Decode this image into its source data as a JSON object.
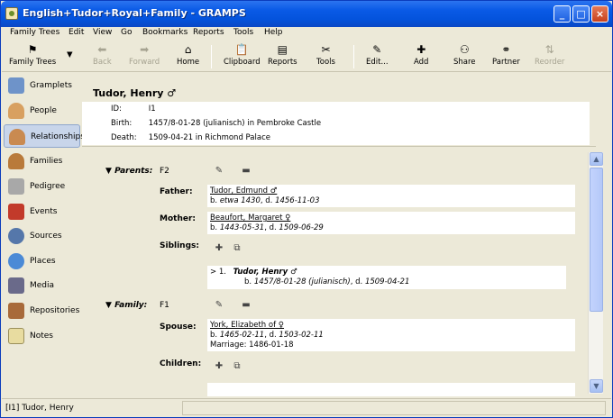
{
  "window": {
    "title": "English+Tudor+Royal+Family - GRAMPS",
    "controls": [
      "_",
      "□",
      "×"
    ]
  },
  "menu": [
    "Family Trees",
    "Edit",
    "View",
    "Go",
    "Bookmarks",
    "Reports",
    "Tools",
    "Help"
  ],
  "toolbar": {
    "family_trees": "Family Trees",
    "back": "Back",
    "forward": "Forward",
    "home": "Home",
    "clipboard": "Clipboard",
    "reports": "Reports",
    "tools": "Tools",
    "edit": "Edit...",
    "add": "Add",
    "share": "Share",
    "partner": "Partner",
    "reorder": "Reorder"
  },
  "sidebar": {
    "items": [
      {
        "label": "Gramplets",
        "color": "#6e93c9"
      },
      {
        "label": "People",
        "color": "#d8a060"
      },
      {
        "label": "Relationships",
        "color": "#c98a50"
      },
      {
        "label": "Families",
        "color": "#b97a3a"
      },
      {
        "label": "Pedigree",
        "color": "#a8a8a8"
      },
      {
        "label": "Events",
        "color": "#c23a2a"
      },
      {
        "label": "Sources",
        "color": "#5577aa"
      },
      {
        "label": "Places",
        "color": "#4b8ad6"
      },
      {
        "label": "Media",
        "color": "#6a6a8a"
      },
      {
        "label": "Repositories",
        "color": "#a86a3a"
      },
      {
        "label": "Notes",
        "color": "#e8dca0"
      }
    ],
    "active_index": 2
  },
  "person": {
    "name": "Tudor, Henry ♂",
    "id_label": "ID:",
    "id_value": "I1",
    "birth_label": "Birth:",
    "birth_value": "1457/8-01-28 (julianisch) in Pembroke Castle",
    "death_label": "Death:",
    "death_value": "1509-04-21 in Richmond Palace"
  },
  "parents": {
    "header": "Parents:",
    "id": "F2",
    "father_label": "Father:",
    "father_name": "Tudor, Edmund ♂",
    "father_dates_b": "b. ",
    "father_birth": "etwa 1430",
    "father_dates_d": ", d. ",
    "father_death": "1456-11-03",
    "mother_label": "Mother:",
    "mother_name": "Beaufort, Margaret ♀",
    "mother_dates_b": "b. ",
    "mother_birth": "1443-05-31",
    "mother_dates_d": ", d. ",
    "mother_death": "1509-06-29",
    "siblings_label": "Siblings:",
    "sibling_prefix": "> 1.",
    "sibling_name": "Tudor, Henry ♂",
    "sibling_dates_b": "b. ",
    "sibling_birth": "1457/8-01-28 (julianisch)",
    "sibling_dates_d": ", d. ",
    "sibling_death": "1509-04-21"
  },
  "family": {
    "header": "Family:",
    "id": "F1",
    "spouse_label": "Spouse:",
    "spouse_name": "York, Elizabeth of ♀",
    "spouse_dates_b": "b. ",
    "spouse_birth": "1465-02-11",
    "spouse_dates_d": ", d. ",
    "spouse_death": "1503-02-11",
    "marriage": "Marriage: 1486-01-18",
    "children_label": "Children:"
  },
  "status": {
    "text": "[I1] Tudor, Henry"
  }
}
